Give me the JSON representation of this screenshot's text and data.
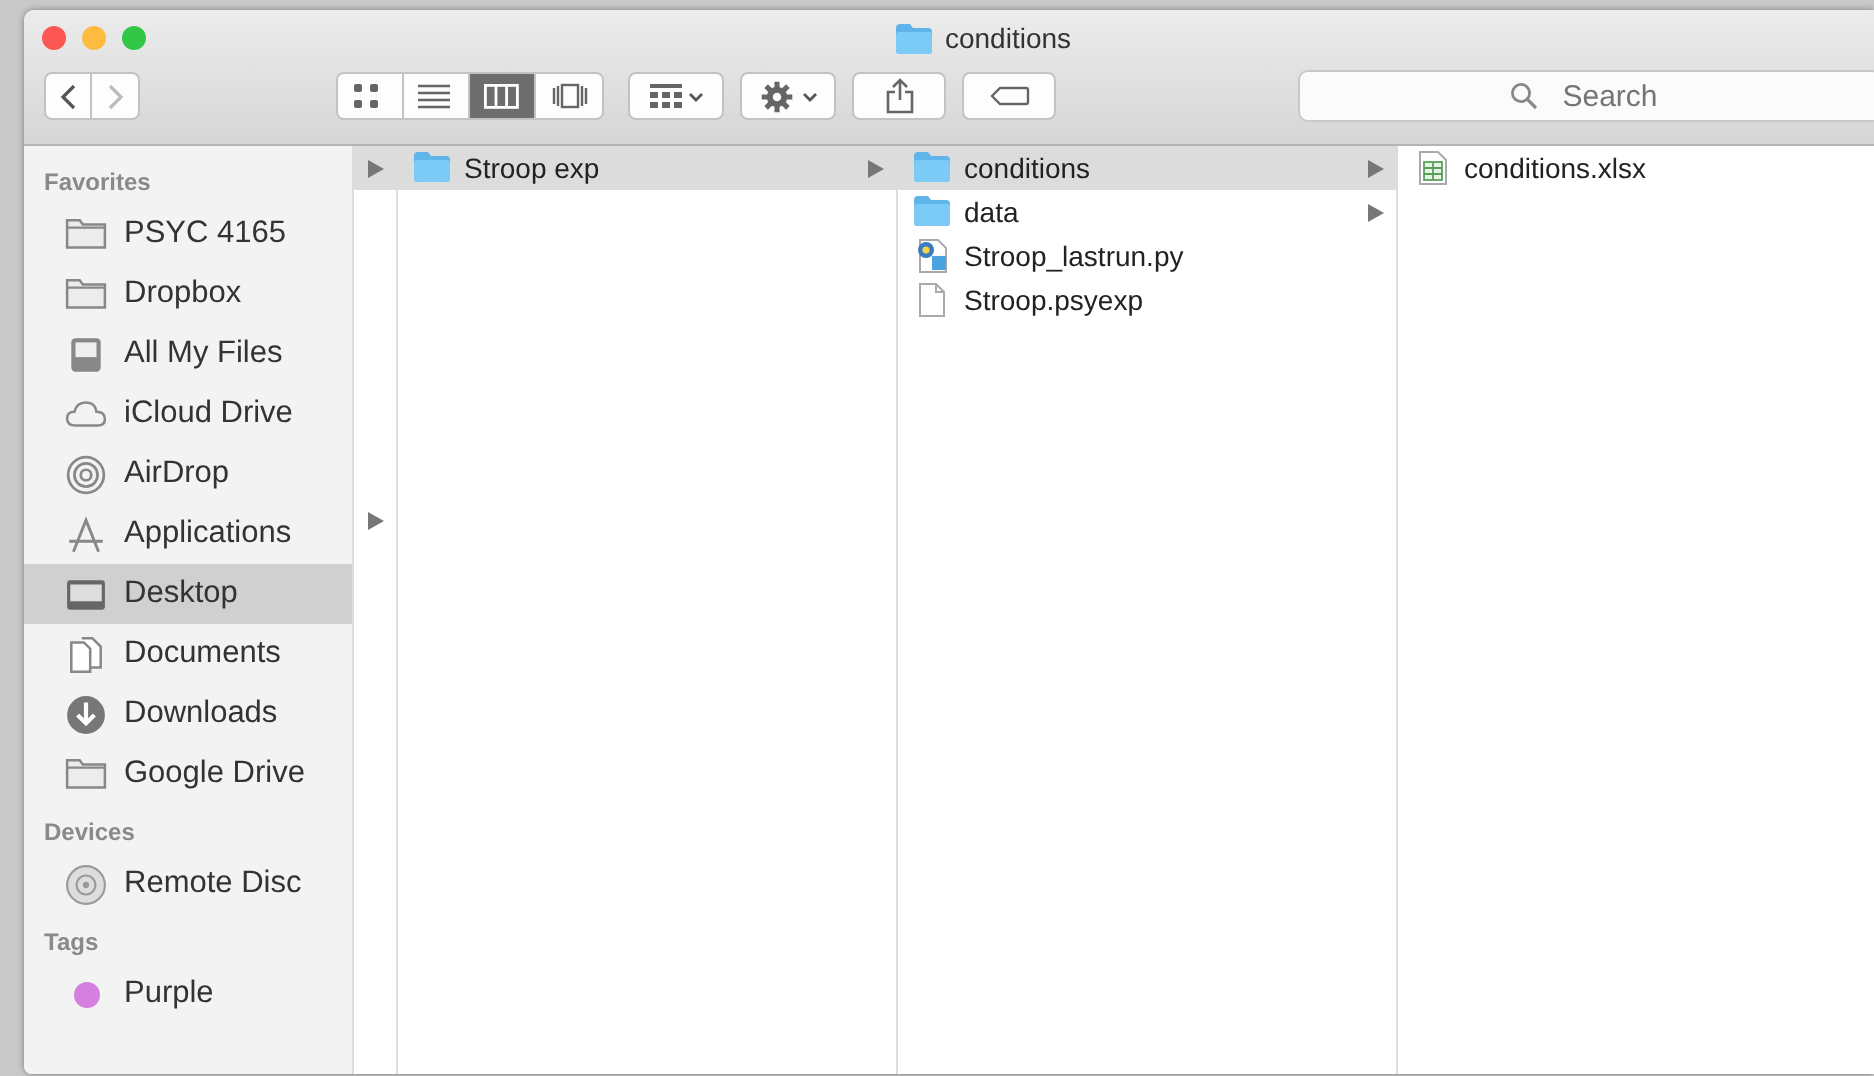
{
  "window": {
    "title": "conditions"
  },
  "toolbar": {
    "views": [
      {
        "kind": "icon",
        "selected": false
      },
      {
        "kind": "list",
        "selected": false
      },
      {
        "kind": "columns",
        "selected": true
      },
      {
        "kind": "coverflow",
        "selected": false
      }
    ],
    "search": {
      "placeholder": "Search"
    }
  },
  "sidebar": {
    "sections": [
      {
        "title": "Favorites",
        "items": [
          {
            "label": "PSYC 4165",
            "kind": "folder",
            "selected": false
          },
          {
            "label": "Dropbox",
            "kind": "folder",
            "selected": false
          },
          {
            "label": "All My Files",
            "kind": "files",
            "selected": false
          },
          {
            "label": "iCloud Drive",
            "kind": "cloud",
            "selected": false
          },
          {
            "label": "AirDrop",
            "kind": "airdrop",
            "selected": false
          },
          {
            "label": "Applications",
            "kind": "apps",
            "selected": false
          },
          {
            "label": "Desktop",
            "kind": "desktop",
            "selected": true
          },
          {
            "label": "Documents",
            "kind": "documents",
            "selected": false
          },
          {
            "label": "Downloads",
            "kind": "downloads",
            "selected": false
          },
          {
            "label": "Google Drive",
            "kind": "folder",
            "selected": false
          }
        ]
      },
      {
        "title": "Devices",
        "items": [
          {
            "label": "Remote Disc",
            "kind": "disc",
            "selected": false
          }
        ]
      },
      {
        "title": "Tags",
        "items": [
          {
            "label": "Purple",
            "kind": "tag",
            "color": "#d580e0",
            "selected": false
          }
        ]
      }
    ]
  },
  "leading_column": {
    "rows": [
      {
        "kind": "arrow",
        "selected": true
      },
      {
        "kind": "blank"
      },
      {
        "kind": "blank"
      },
      {
        "kind": "blank"
      },
      {
        "kind": "blank"
      },
      {
        "kind": "blank"
      },
      {
        "kind": "blank"
      },
      {
        "kind": "blank"
      },
      {
        "kind": "arrow",
        "selected": false
      }
    ]
  },
  "columns": [
    {
      "items": [
        {
          "name": "Stroop exp",
          "kind": "folder",
          "expandable": true,
          "selected": true
        }
      ]
    },
    {
      "items": [
        {
          "name": "conditions",
          "kind": "folder",
          "expandable": true,
          "selected": true
        },
        {
          "name": "data",
          "kind": "folder",
          "expandable": true,
          "selected": false
        },
        {
          "name": "Stroop_lastrun.py",
          "kind": "python",
          "expandable": false,
          "selected": false
        },
        {
          "name": "Stroop.psyexp",
          "kind": "document",
          "expandable": false,
          "selected": false
        }
      ]
    },
    {
      "items": [
        {
          "name": "conditions.xlsx",
          "kind": "spreadsheet",
          "expandable": false,
          "selected": false
        }
      ]
    }
  ]
}
